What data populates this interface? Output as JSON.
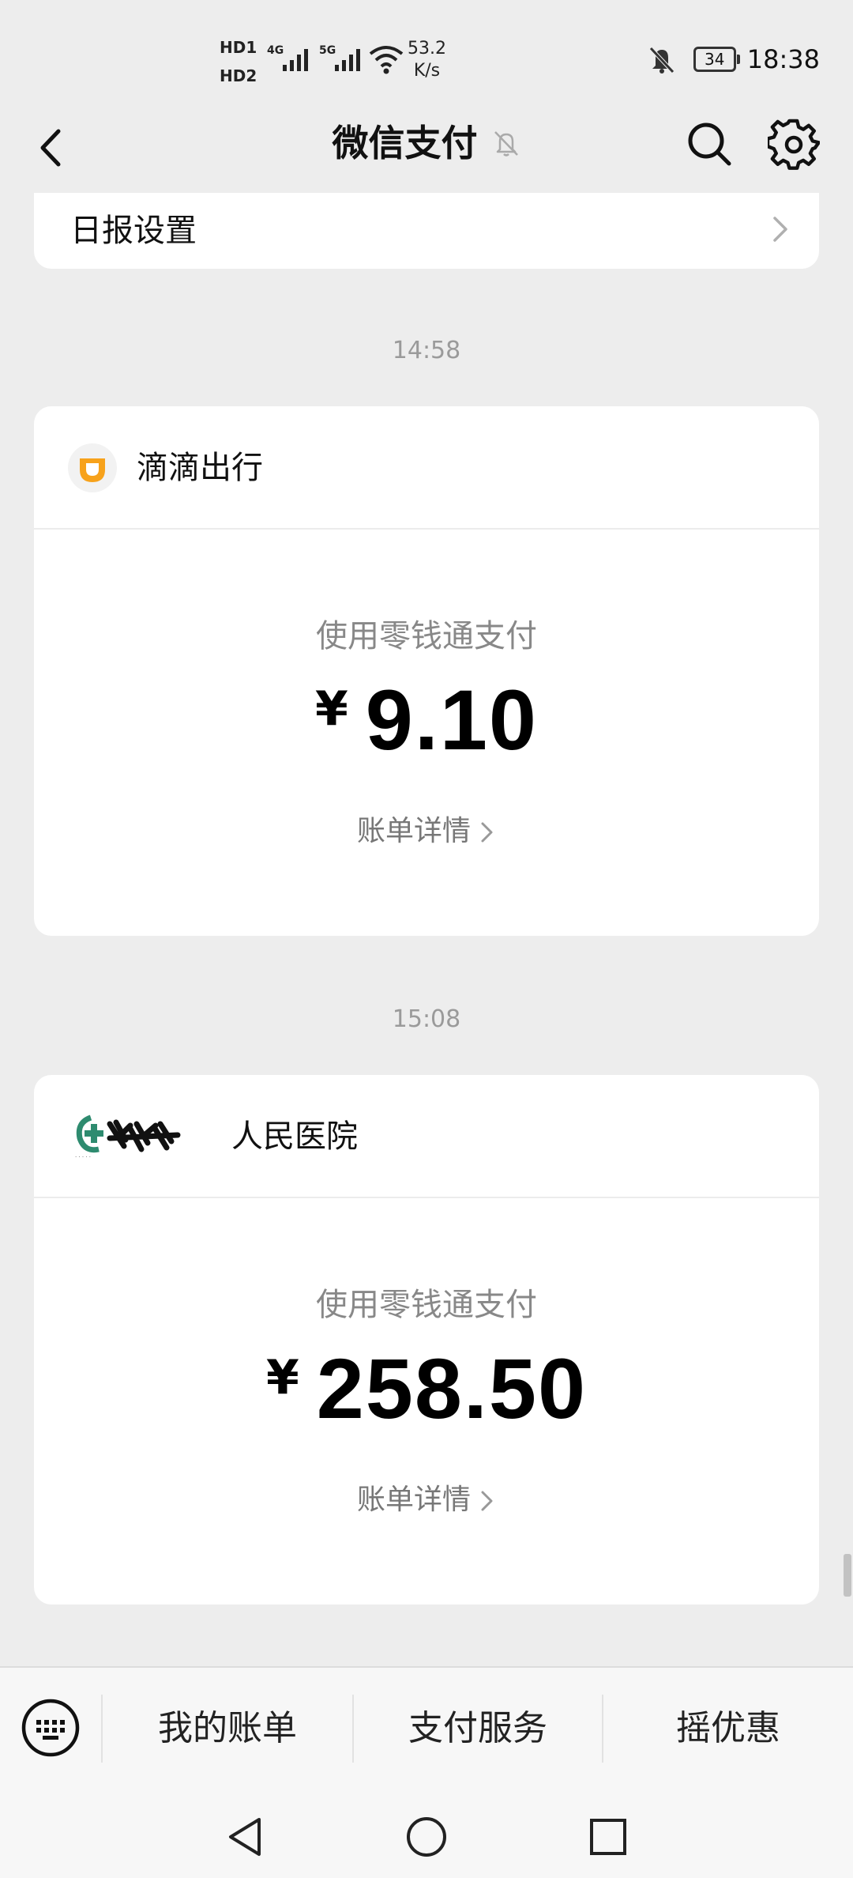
{
  "status_bar": {
    "hd1": "HD1",
    "hd2": "HD2",
    "net4g": "4G",
    "net5g": "5G",
    "speed_value": "53.2",
    "speed_unit": "K/s",
    "battery": "34",
    "time": "18:38"
  },
  "header": {
    "title": "微信支付"
  },
  "report": {
    "label": "日报设置"
  },
  "messages": [
    {
      "time": "14:58",
      "merchant": "滴滴出行",
      "method": "使用零钱通支付",
      "currency": "¥",
      "amount": "9.10",
      "detail": "账单详情"
    },
    {
      "time": "15:08",
      "merchant": "人民医院",
      "method": "使用零钱通支付",
      "currency": "¥",
      "amount": "258.50",
      "detail": "账单详情"
    }
  ],
  "bottom_menu": {
    "items": [
      "我的账单",
      "支付服务",
      "摇优惠"
    ]
  },
  "colors": {
    "background": "#ededed",
    "card": "#ffffff",
    "didi_orange": "#f7a21b",
    "hospital_green": "#2e8b6f"
  },
  "icons": {
    "back": "chevron-left-icon",
    "mute": "bell-off-icon",
    "search": "search-icon",
    "settings": "gear-icon",
    "keyboard": "keyboard-icon"
  }
}
